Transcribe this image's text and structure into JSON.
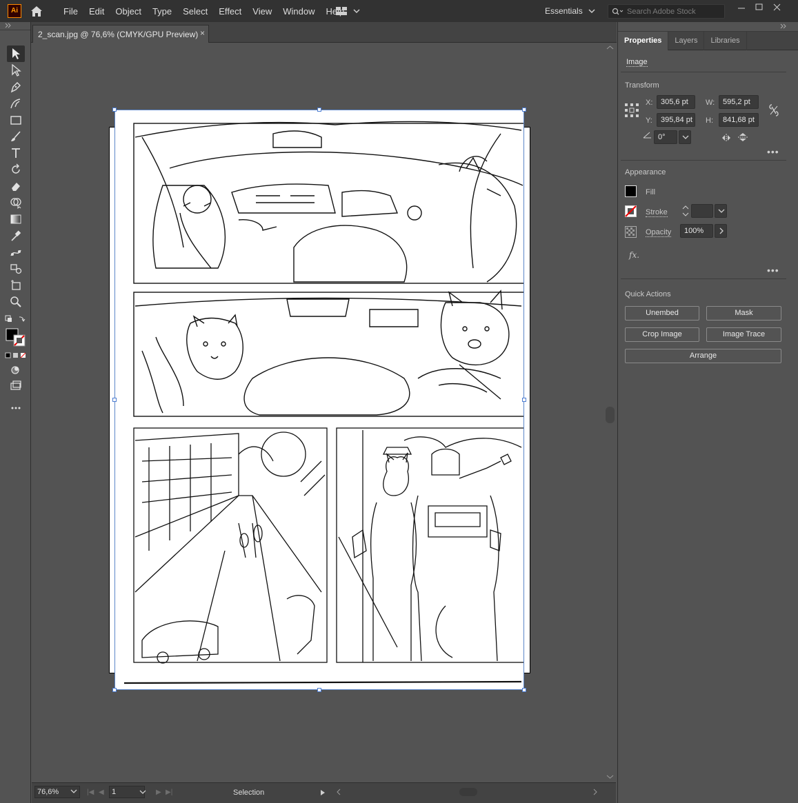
{
  "app": {
    "logo": "Ai"
  },
  "menu": [
    "File",
    "Edit",
    "Object",
    "Type",
    "Select",
    "Effect",
    "View",
    "Window",
    "Help"
  ],
  "workspace": "Essentials",
  "search": {
    "placeholder": "Search Adobe Stock"
  },
  "document": {
    "tab_title": "2_scan.jpg @ 76,6% (CMYK/GPU Preview)",
    "close": "×"
  },
  "status": {
    "zoom": "76,6%",
    "artboard": "1",
    "tool": "Selection"
  },
  "panel": {
    "tabs": [
      "Properties",
      "Layers",
      "Libraries"
    ],
    "object_type": "Image",
    "transform": {
      "title": "Transform",
      "x_label": "X:",
      "x": "305,6 pt",
      "y_label": "Y:",
      "y": "395,84 pt",
      "w_label": "W:",
      "w": "595,2 pt",
      "h_label": "H:",
      "h": "841,68 pt",
      "angle": "0°"
    },
    "appearance": {
      "title": "Appearance",
      "fill": "Fill",
      "stroke": "Stroke",
      "opacity_label": "Opacity",
      "opacity": "100%",
      "fx": "fx."
    },
    "quick_actions": {
      "title": "Quick Actions",
      "unembed": "Unembed",
      "mask": "Mask",
      "crop": "Crop Image",
      "trace": "Image Trace",
      "arrange": "Arrange"
    }
  },
  "colors": {
    "accent": "#ff9a00",
    "selection": "#4a7bd1",
    "ui_dark": "#323232",
    "ui_mid": "#535353"
  }
}
